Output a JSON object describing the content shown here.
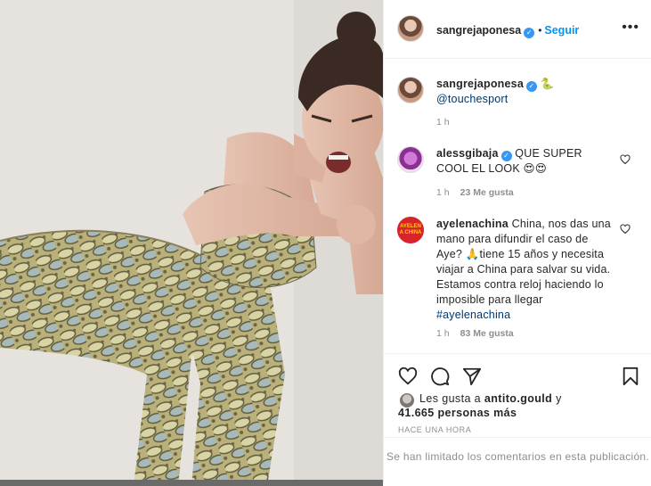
{
  "header": {
    "username": "sangrejaponesa",
    "separator": "•",
    "follow_label": "Seguir",
    "more_label": "•••"
  },
  "caption": {
    "username": "sangrejaponesa",
    "emoji": "🐍",
    "mention": "@touchesport",
    "time": "1 h"
  },
  "comments": [
    {
      "username": "alessgibaja",
      "text": "QUE SUPER COOL EL LOOK 😍😍",
      "time": "1 h",
      "likes": "23 Me gusta"
    },
    {
      "username": "ayelenachina",
      "avatar_text": "AYELEN A CHINA",
      "text": "China, nos das una mano para difundir el caso de Aye? 🙏tiene 15 años y necesita viajar a China para salvar su vida. Estamos contra reloj haciendo lo imposible para llegar",
      "hashtag": "#ayelenachina",
      "time": "1 h",
      "likes": "83 Me gusta"
    }
  ],
  "likes_block": {
    "prefix": "Les gusta a",
    "user": "antito.gould",
    "connector": "y",
    "count": "41.665 personas más"
  },
  "timestamp": "HACE UNA HORA",
  "limited_comments": "Se han limitado los comentarios en esta publicación.",
  "icons": [
    "heart-icon",
    "comment-icon",
    "share-icon",
    "bookmark-icon",
    "verified-icon",
    "more-icon"
  ],
  "colors": {
    "link": "#0095f6",
    "muted": "#8e8e8e",
    "verified": "#3897f0",
    "text": "#262626"
  }
}
